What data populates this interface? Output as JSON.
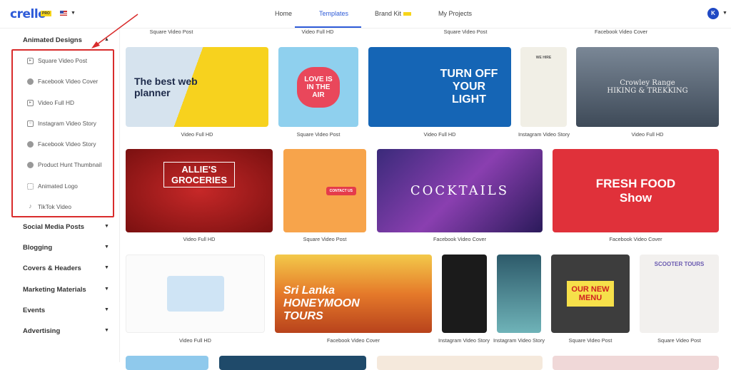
{
  "header": {
    "logo": "crello",
    "pro_badge": "PRO",
    "flag": "us-flag-icon",
    "nav": [
      "Home",
      "Templates",
      "Brand Kit",
      "My Projects"
    ],
    "active_tab": "Templates",
    "new_badge": "NEW",
    "avatar_initial": "K"
  },
  "sidebar": {
    "expanded": "Animated Designs",
    "subitems": [
      {
        "label": "Square Video Post",
        "icon": "play-icon"
      },
      {
        "label": "Facebook Video Cover",
        "icon": "facebook-icon"
      },
      {
        "label": "Video Full HD",
        "icon": "play-icon"
      },
      {
        "label": "Instagram Video Story",
        "icon": "instagram-icon"
      },
      {
        "label": "Facebook Video Story",
        "icon": "facebook-icon"
      },
      {
        "label": "Product Hunt Thumbnail",
        "icon": "product-hunt-icon"
      },
      {
        "label": "Animated Logo",
        "icon": "logo-icon"
      },
      {
        "label": "TikTok Video",
        "icon": "tiktok-icon"
      }
    ],
    "categories": [
      "Social Media Posts",
      "Blogging",
      "Covers & Headers",
      "Marketing Materials",
      "Events",
      "Advertising"
    ],
    "highlight_color": "#d92c2c"
  },
  "top_captions": [
    "Square Video Post",
    "Video Full HD",
    "Square Video Post",
    "Facebook Video Cover"
  ],
  "cards": [
    {
      "caption": "Video Full HD",
      "text": "The best web planner"
    },
    {
      "caption": "Square Video Post",
      "text": "LOVE IS IN THE AIR"
    },
    {
      "caption": "Video Full HD",
      "text": "TURN OFF YOUR LIGHT"
    },
    {
      "caption": "Instagram Video Story",
      "text": "WE HIRE"
    },
    {
      "caption": "Video Full HD",
      "text": "Crowley Range HIKING & TREKKING"
    },
    {
      "caption": "Video Full HD",
      "text": "ALLIE'S GROCERIES"
    },
    {
      "caption": "Square Video Post",
      "text": "CONTACT US"
    },
    {
      "caption": "Facebook Video Cover",
      "text": "COCKTAILS"
    },
    {
      "caption": "Facebook Video Cover",
      "text": "FRESH FOOD Show"
    },
    {
      "caption": "Video Full HD",
      "text": ""
    },
    {
      "caption": "Facebook Video Cover",
      "text": "Sri Lanka HONEYMOON TOURS"
    },
    {
      "caption": "Instagram Video Story",
      "text": ""
    },
    {
      "caption": "Instagram Video Story",
      "text": ""
    },
    {
      "caption": "Square Video Post",
      "text": "OUR NEW MENU"
    },
    {
      "caption": "Square Video Post",
      "text": "SCOOTER TOURS"
    }
  ]
}
